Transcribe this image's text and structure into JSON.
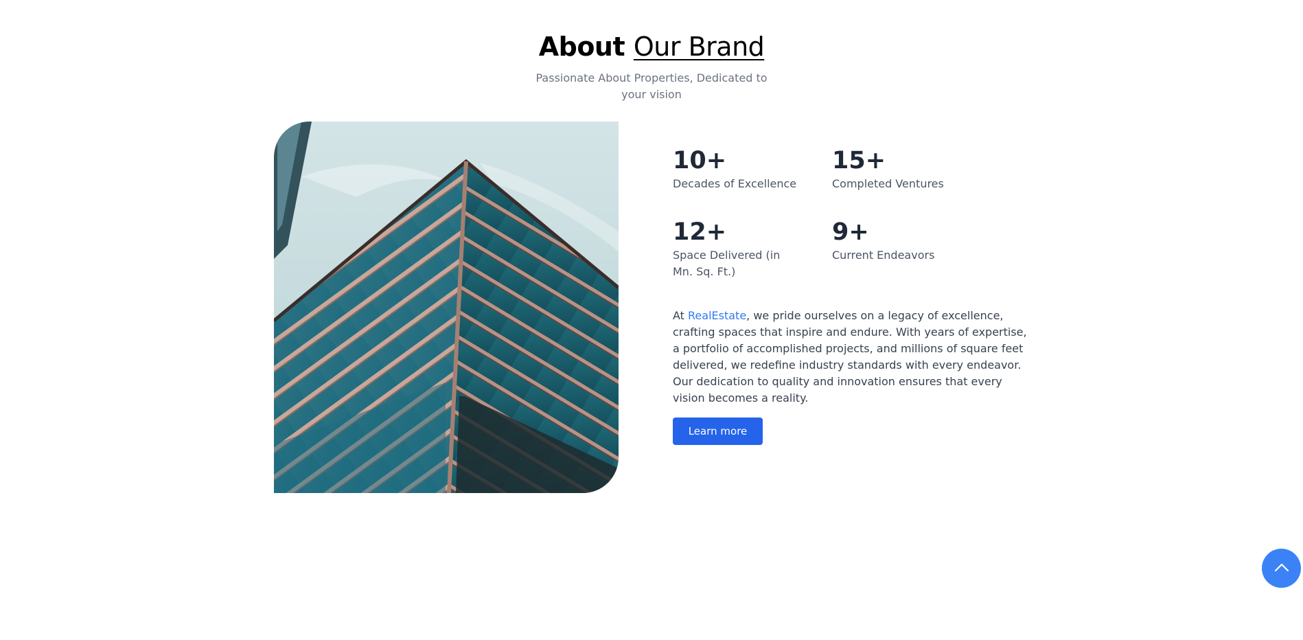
{
  "about": {
    "title_bold": "About",
    "title_rest": "Our Brand",
    "subtitle": "Passionate About Properties, Dedicated to your vision"
  },
  "stats": [
    {
      "value": "10+",
      "label": "Decades of Excellence"
    },
    {
      "value": "15+",
      "label": "Completed Ventures"
    },
    {
      "value": "12+",
      "label": "Space Delivered (in Mn. Sq. Ft.)"
    },
    {
      "value": "9+",
      "label": "Current Endeavors"
    }
  ],
  "description": {
    "prefix": "At ",
    "brand": "RealEstate",
    "body": ", we pride ourselves on a legacy of excellence, crafting spaces that inspire and endure. With years of expertise, a portfolio of accomplished projects, and millions of square feet delivered, we redefine industry standards with every endeavor. Our dedication to quality and innovation ensures that every vision becomes a reality."
  },
  "cta": {
    "learn_more_label": "Learn more"
  },
  "icons": {
    "scroll_top": "chevron-up-icon"
  },
  "colors": {
    "accent": "#2563eb",
    "brand_link": "#2f7bf5",
    "scroll_button": "#3b82f6"
  }
}
